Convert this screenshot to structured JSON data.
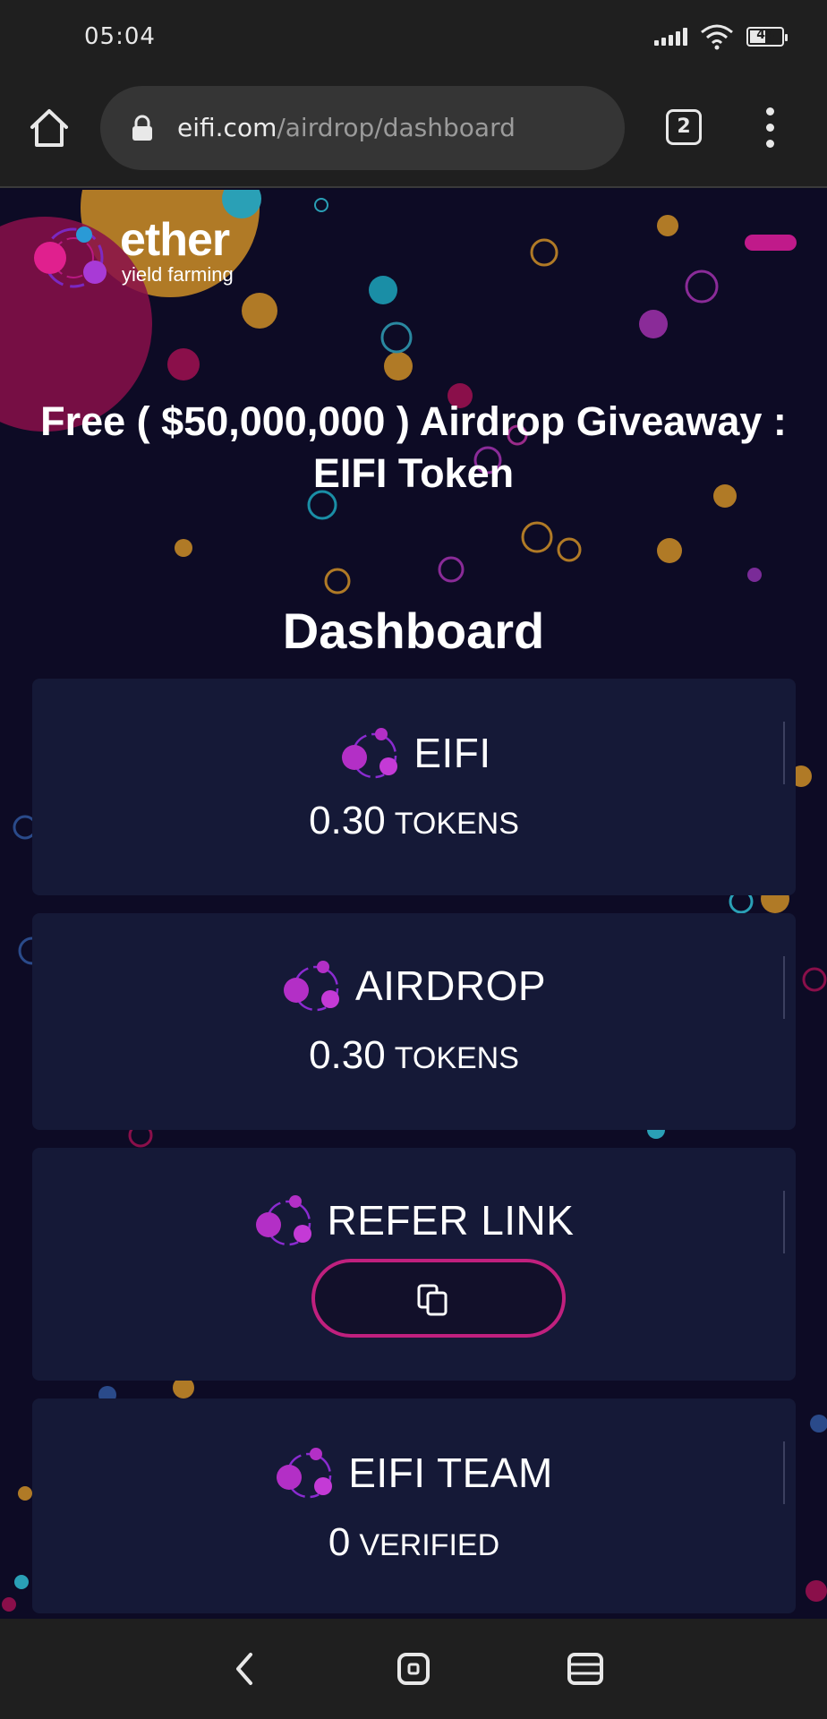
{
  "status_bar": {
    "time": "05:04",
    "battery": "44"
  },
  "browser": {
    "url_domain": "eifi.com",
    "url_path": "/airdrop/dashboard",
    "tab_count": "2"
  },
  "logo": {
    "name": "ether",
    "tagline": "yield farming"
  },
  "headline": "Free ( $50,000,000 ) Airdrop Giveaway : EIFI Token",
  "dashboard_title": "Dashboard",
  "cards": [
    {
      "label": "EIFI",
      "value": "0.30",
      "unit": "TOKENS"
    },
    {
      "label": "AIRDROP",
      "value": "0.30",
      "unit": "TOKENS"
    },
    {
      "label": "REFER LINK"
    },
    {
      "label": "EIFI TEAM",
      "value": "0",
      "unit": "VERIFIED"
    }
  ],
  "colors": {
    "accent": "#c01a8a",
    "card_bg": "#151937",
    "page_bg": "#0d0b25"
  },
  "icons": [
    "home-icon",
    "lock-icon",
    "tabs-icon",
    "more-vert-icon",
    "copy-icon",
    "back-nav-icon",
    "home-nav-icon",
    "recents-nav-icon"
  ]
}
